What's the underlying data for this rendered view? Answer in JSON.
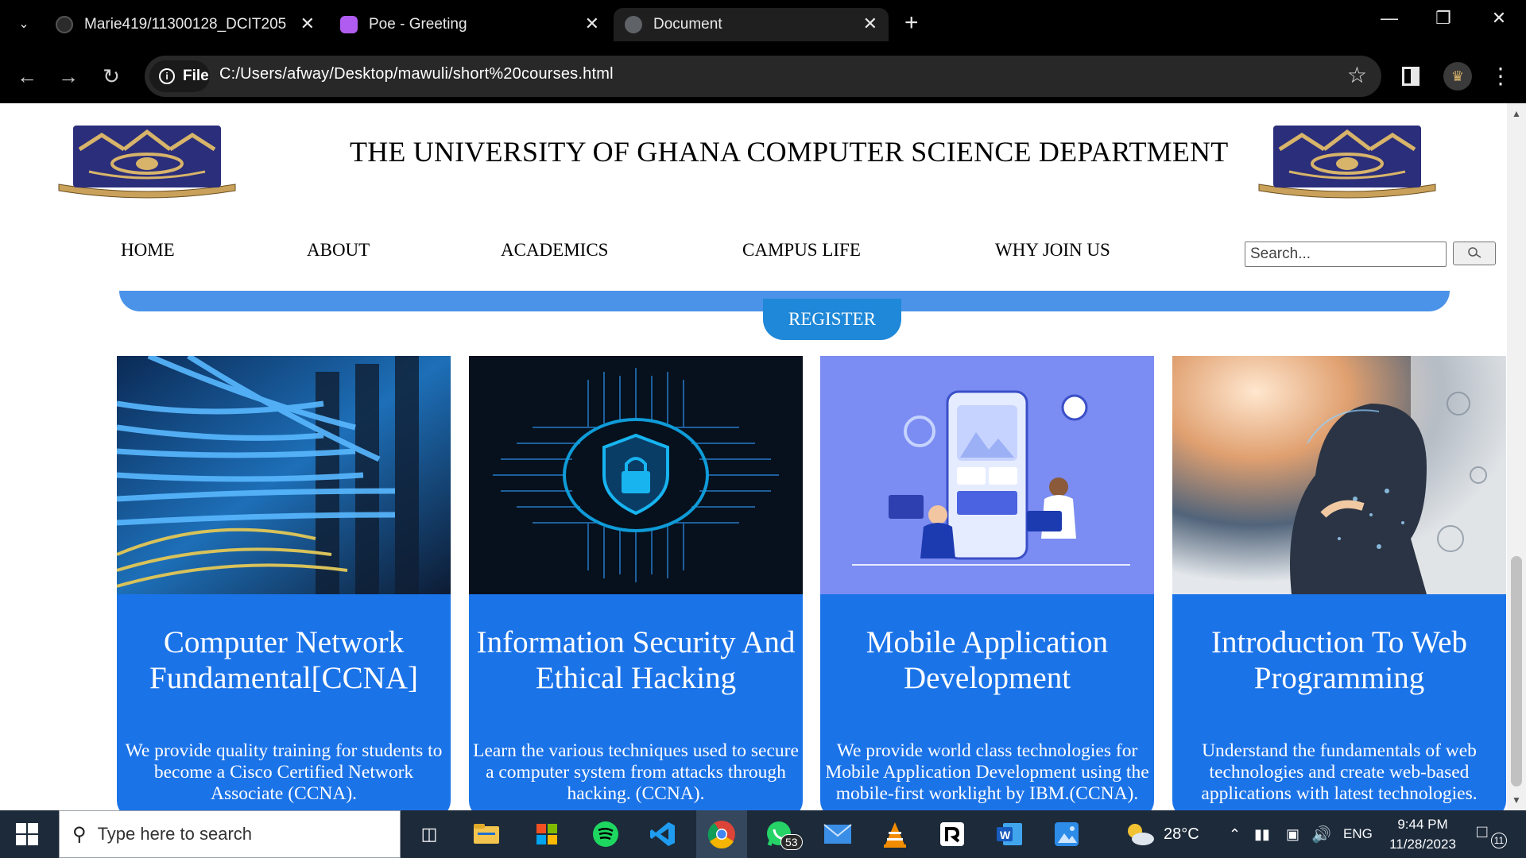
{
  "browser": {
    "tabs": [
      {
        "title": "Marie419/11300128_DCIT205",
        "icon": "github-icon"
      },
      {
        "title": "Poe - Greeting",
        "icon": "poe-icon"
      },
      {
        "title": "Document",
        "icon": "globe-icon"
      }
    ],
    "omnibox": {
      "scheme_label": "File",
      "url": "C:/Users/afway/Desktop/mawuli/short%20courses.html"
    }
  },
  "page": {
    "title": "THE UNIVERSITY OF GHANA COMPUTER SCIENCE DEPARTMENT",
    "logo_motto": "INTEGRI PROCEDAMUS",
    "nav": [
      {
        "label": "HOME"
      },
      {
        "label": "ABOUT"
      },
      {
        "label": "ACADEMICS"
      },
      {
        "label": "CAMPUS LIFE"
      },
      {
        "label": "WHY JOIN US"
      }
    ],
    "search": {
      "placeholder": "Search...",
      "button_icon": "search-icon"
    },
    "register_label": "REGISTER",
    "courses": [
      {
        "title": "Computer Network Fundamental[CCNA]",
        "description": "We provide quality training for students to become a Cisco Certified Network Associate (CCNA).",
        "image": "network-cables-image"
      },
      {
        "title": "Information Security And Ethical Hacking",
        "description": "Learn the various techniques used to secure a computer system from attacks through hacking. (CCNA).",
        "image": "security-shield-image"
      },
      {
        "title": "Mobile Application Development",
        "description": "We provide world class technologies for Mobile Application Development using the mobile-first worklight by IBM.(CCNA).",
        "image": "mobile-development-image"
      },
      {
        "title": "Introduction To Web Programming",
        "description": "Understand the fundamentals of web technologies and create web-based applications with latest technologies.",
        "image": "ai-person-image"
      }
    ],
    "colors": {
      "card": "#1b73e8",
      "band": "#4a93e8",
      "register": "#1f88d8"
    }
  },
  "taskbar": {
    "search_placeholder": "Type here to search",
    "whatsapp_badge": "53",
    "weather": "28°C",
    "language": "ENG",
    "time": "9:44 PM",
    "date": "11/28/2023",
    "notifications": "11"
  }
}
